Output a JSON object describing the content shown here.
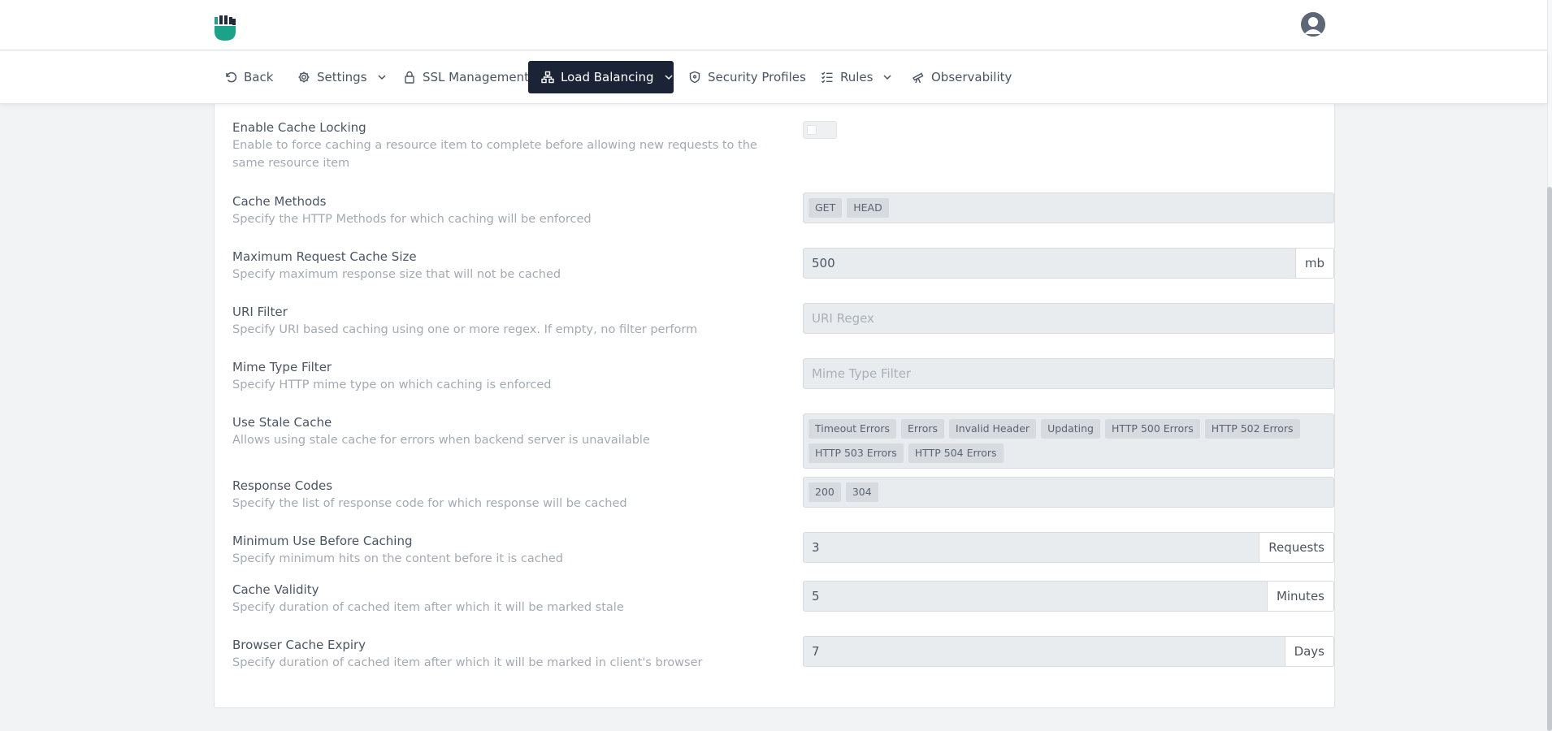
{
  "nav": {
    "back": "Back",
    "settings": "Settings",
    "ssl": "SSL Management",
    "load_balancing": "Load Balancing",
    "security_profiles": "Security Profiles",
    "rules": "Rules",
    "observability": "Observability"
  },
  "settings": {
    "cache_locking": {
      "label": "Enable Cache Locking",
      "desc": "Enable to force caching a resource item to complete before allowing new requests to the same resource item",
      "enabled": false
    },
    "cache_methods": {
      "label": "Cache Methods",
      "desc": "Specify the HTTP Methods for which caching will be enforced",
      "tags": [
        "GET",
        "HEAD"
      ]
    },
    "max_request_size": {
      "label": "Maximum Request Cache Size",
      "desc": "Specify maximum response size that will not be cached",
      "value": "500",
      "unit": "mb"
    },
    "uri_filter": {
      "label": "URI Filter",
      "desc": "Specify URI based caching using one or more regex. If empty, no filter perform",
      "placeholder": "URI Regex"
    },
    "mime_filter": {
      "label": "Mime Type Filter",
      "desc": "Specify HTTP mime type on which caching is enforced",
      "placeholder": "Mime Type Filter"
    },
    "stale_cache": {
      "label": "Use Stale Cache",
      "desc": "Allows using stale cache for errors when backend server is unavailable",
      "tags": [
        "Timeout Errors",
        "Errors",
        "Invalid Header",
        "Updating",
        "HTTP 500 Errors",
        "HTTP 502 Errors",
        "HTTP 503 Errors",
        "HTTP 504 Errors"
      ]
    },
    "response_codes": {
      "label": "Response Codes",
      "desc": "Specify the list of response code for which response will be cached",
      "tags": [
        "200",
        "304"
      ]
    },
    "min_use": {
      "label": "Minimum Use Before Caching",
      "desc": "Specify minimum hits on the content before it is cached",
      "value": "3",
      "unit": "Requests"
    },
    "cache_validity": {
      "label": "Cache Validity",
      "desc": "Specify duration of cached item after which it will be marked stale",
      "value": "5",
      "unit": "Minutes"
    },
    "browser_expiry": {
      "label": "Browser Cache Expiry",
      "desc": "Specify duration of cached item after which it will be marked in client's browser",
      "value": "7",
      "unit": "Days"
    }
  },
  "colors": {
    "nav_active_bg": "#1b2437",
    "logo": "#1aa389"
  }
}
